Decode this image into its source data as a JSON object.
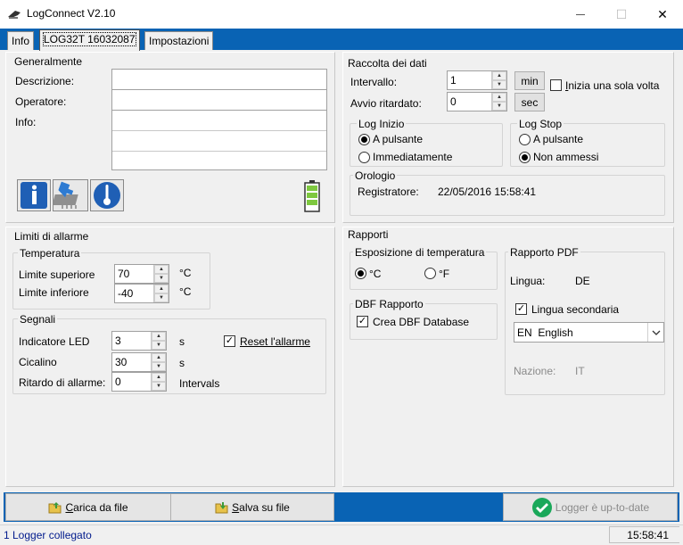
{
  "window": {
    "title": "LogConnect V2.10",
    "minimize_glyph": "—",
    "maximize_glyph": "☐",
    "close_glyph": "✕"
  },
  "tabs": [
    {
      "label": "Info"
    },
    {
      "label": "LOG32T 16032087"
    },
    {
      "label": "Impostazioni"
    }
  ],
  "general": {
    "title": "Generalmente",
    "description_label": "Descrizione:",
    "operator_label": "Operatore:",
    "info_label": "Info:",
    "description_value": "",
    "operator_value": "",
    "info_value": ""
  },
  "data_collection": {
    "title": "Raccolta dei dati",
    "interval_label": "Intervallo:",
    "interval_value": "1",
    "interval_unit": "min",
    "delay_label": "Avvio ritardato:",
    "delay_value": "0",
    "delay_unit": "sec",
    "single_start_label": "Inizia una sola volta",
    "single_start_checked": false
  },
  "log_start": {
    "title": "Log Inizio",
    "opt1": "A pulsante",
    "opt2": "Immediatamente",
    "selected": "opt1"
  },
  "log_stop": {
    "title": "Log Stop",
    "opt1": "A pulsante",
    "opt2": "Non ammessi",
    "selected": "opt2"
  },
  "clock": {
    "title": "Orologio",
    "label": "Registratore:",
    "value": "22/05/2016 15:58:41"
  },
  "alarms": {
    "title": "Limiti di allarme",
    "temperature_title": "Temperatura",
    "upper_label": "Limite superiore",
    "upper_value": "70",
    "lower_label": "Limite inferiore",
    "lower_value": "-40",
    "unit": "°C",
    "signals_title": "Segnali",
    "led_label": "Indicatore LED",
    "led_value": "3",
    "buzzer_label": "Cicalino",
    "buzzer_value": "30",
    "delay_label": "Ritardo di allarme:",
    "delay_value": "0",
    "sec_unit": "s",
    "intervals_unit": "Intervals",
    "reset_label": "Reset l'allarme",
    "reset_checked": true
  },
  "reports": {
    "title": "Rapporti",
    "temp_title": "Esposizione di temperatura",
    "celsius": "°C",
    "fahrenheit": "°F",
    "temp_selected": "celsius",
    "dbf_title": "DBF Rapporto",
    "dbf_label": "Crea DBF Database",
    "dbf_checked": true,
    "pdf_title": "Rapporto PDF",
    "language_label": "Lingua:",
    "language_value": "DE",
    "secondary_label": "Lingua secondaria",
    "secondary_checked": true,
    "secondary_select": "EN  English",
    "country_label": "Nazione:",
    "country_value": "IT"
  },
  "buttons": {
    "load": "Carica da file",
    "save": "Salva su file",
    "status": "Logger è up-to-date"
  },
  "status_bar": {
    "left": "1 Logger collegato",
    "right": "15:58:41"
  },
  "colors": {
    "accent": "#0963b4",
    "ok_green": "#1aa85a",
    "status_text": "#001a8c"
  }
}
